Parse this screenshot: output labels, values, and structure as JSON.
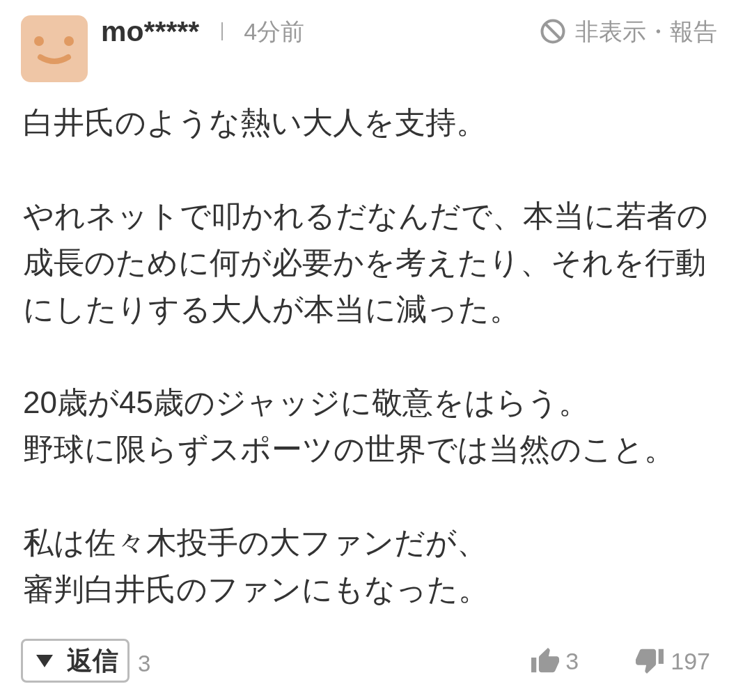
{
  "comment": {
    "author": "mo*****",
    "time": "4分前",
    "hide_report": "非表示・報告",
    "paragraphs": [
      [
        "白井氏のような熱い大人を支持。"
      ],
      [
        "やれネットで叩かれるだなんだで、本当に若者の成長のために何が必要かを考えたり、それを行動にしたりする大人が本当に減った。"
      ],
      [
        "20歳が45歳のジャッジに敬意をはらう。",
        "野球に限らずスポーツの世界では当然のこと。"
      ],
      [
        "私は佐々木投手の大ファンだが、",
        "審判白井氏のファンにもなった。"
      ]
    ],
    "reply_button": "返信",
    "reply_count": "3",
    "likes": "3",
    "dislikes": "197"
  }
}
